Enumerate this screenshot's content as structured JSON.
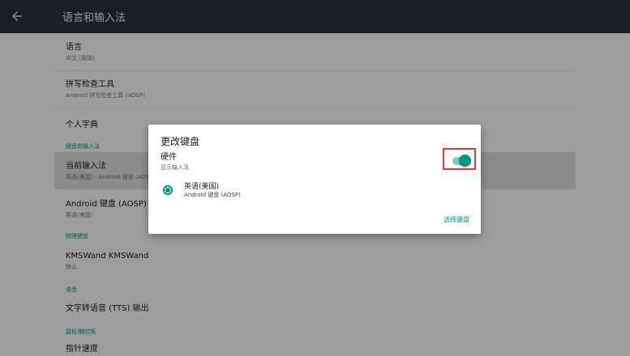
{
  "appbar": {
    "title": "语言和输入法",
    "back_icon": "arrow-left-icon"
  },
  "list": {
    "language": {
      "title": "语言",
      "summary": "中文 (简体)"
    },
    "spell": {
      "title": "拼写检查工具",
      "summary": "Android 拼写检查工具 (AOSP)"
    },
    "dict": {
      "title": "个人字典"
    },
    "cat_keyboard": "键盘和输入法",
    "current_ime": {
      "title": "当前输入法",
      "summary": "英语(美国) - Android 键盘 (AOSP)"
    },
    "android_kb": {
      "title": "Android 键盘 (AOSP)",
      "summary": "英语(美国)"
    },
    "cat_physical": "物理键盘",
    "kmswand": {
      "title": "KMSWand KMSWand",
      "summary": "默认"
    },
    "cat_speech": "语音",
    "tts": {
      "title": "文字转语音 (TTS) 输出"
    },
    "cat_pointer": "鼠标/触控板",
    "pointer": {
      "title": "指针速度"
    }
  },
  "dialog": {
    "title": "更改键盘",
    "section": "硬件",
    "section_sub": "显示输入法",
    "toggle_on": true,
    "option": {
      "title": "英语(美国)",
      "summary": "Android 键盘 (AOSP)",
      "selected": true
    },
    "action": "选择键盘"
  },
  "colors": {
    "accent": "#009688",
    "appbar": "#263238",
    "highlight_box": "#e53935"
  }
}
